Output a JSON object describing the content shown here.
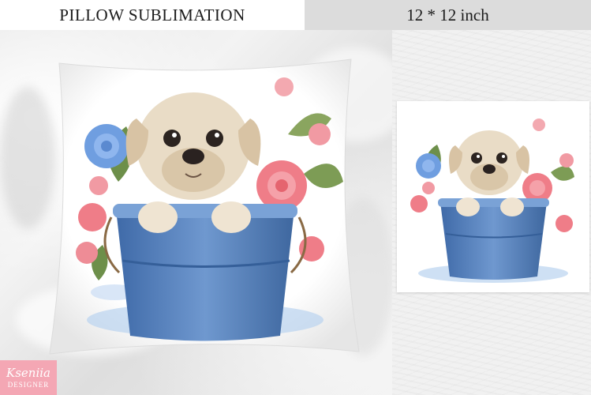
{
  "header": {
    "left_title": "PILLOW SUBLIMATION",
    "right_title": "12 * 12 inch"
  },
  "logo": {
    "name": "Kseniia",
    "subtitle": "DESIGNER"
  },
  "colors": {
    "header_left_bg": "#ffffff",
    "header_right_bg": "#dcdcdc",
    "bucket_blue": "#4f78b3",
    "rose_pink": "#ef7d88",
    "blue_rose": "#6f9ee0",
    "puppy_fur": "#e9dcc6",
    "logo_pink": "#f4a7b4"
  },
  "icons": {
    "pillow_artwork": "puppy-in-bucket-with-roses",
    "print_artwork": "puppy-in-bucket-with-roses"
  }
}
